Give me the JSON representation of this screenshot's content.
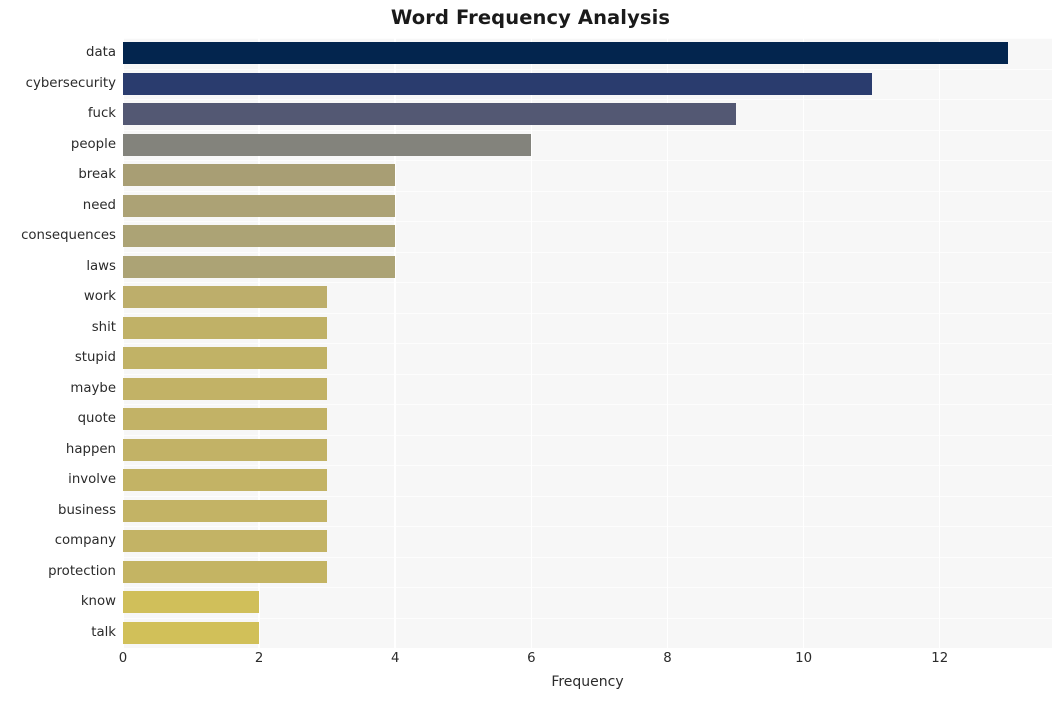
{
  "chart_data": {
    "type": "bar",
    "orientation": "horizontal",
    "title": "Word Frequency Analysis",
    "xlabel": "Frequency",
    "ylabel": "",
    "xlim": [
      0,
      13.65
    ],
    "xticks": [
      0,
      2,
      4,
      6,
      8,
      10,
      12
    ],
    "xticklabels": [
      "0",
      "2",
      "4",
      "6",
      "8",
      "10",
      "12"
    ],
    "grid": true,
    "legend": "none",
    "categories": [
      "data",
      "cybersecurity",
      "fuck",
      "people",
      "break",
      "need",
      "consequences",
      "laws",
      "work",
      "shit",
      "stupid",
      "maybe",
      "quote",
      "happen",
      "involve",
      "business",
      "company",
      "protection",
      "know",
      "talk"
    ],
    "values": [
      13,
      11,
      9,
      6,
      4,
      4,
      4,
      4,
      3,
      3,
      3,
      3,
      3,
      3,
      3,
      3,
      3,
      3,
      2,
      2
    ],
    "bar_colors": [
      "#03254e",
      "#2a3c6e",
      "#535873",
      "#83837c",
      "#a89e74",
      "#ac a275",
      "#aca375",
      "#aca375",
      "#bdae6b",
      "#c0b167",
      "#c1b266",
      "#c2b266",
      "#c2b266",
      "#c2b266",
      "#c3b365",
      "#c3b365",
      "#c3b365",
      "#c4b463",
      "#d0bf5a",
      "#d1c059"
    ],
    "panel_background": "#f7f7f7",
    "gridline_color": "#ffffff",
    "figure_background": "#ffffff"
  }
}
